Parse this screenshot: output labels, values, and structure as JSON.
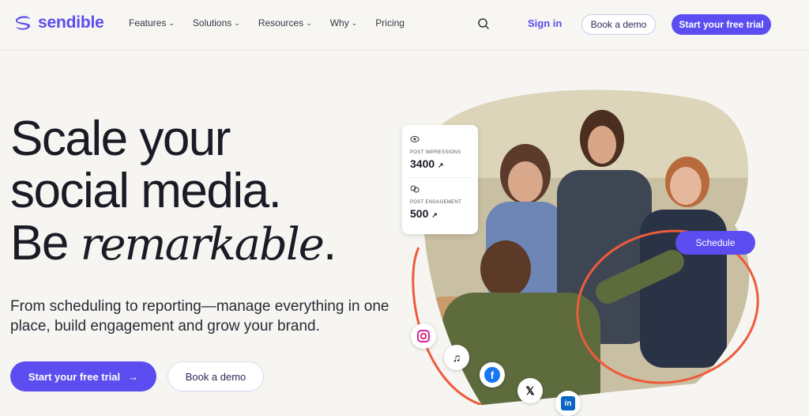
{
  "brand": {
    "name": "sendible",
    "color": "#5b4df0"
  },
  "nav": {
    "items": [
      {
        "label": "Features",
        "has_dropdown": true
      },
      {
        "label": "Solutions",
        "has_dropdown": true
      },
      {
        "label": "Resources",
        "has_dropdown": true
      },
      {
        "label": "Why",
        "has_dropdown": true
      },
      {
        "label": "Pricing",
        "has_dropdown": false
      }
    ],
    "search_icon": "search-icon",
    "sign_in": "Sign in",
    "book_demo": "Book a demo",
    "start_trial": "Start your free trial"
  },
  "hero": {
    "line1": "Scale your",
    "line2": "social media.",
    "line3_prefix": "Be ",
    "line3_italic": "remarkable",
    "line3_suffix": ".",
    "subtitle": "From scheduling to reporting—manage everything in one place, build engagement and grow your brand.",
    "cta_primary": "Start your free trial",
    "cta_primary_icon": "arrow-right-icon",
    "cta_secondary": "Book a demo"
  },
  "stats_card": {
    "impressions_label": "POST IMPRESSIONS",
    "impressions_value": "3400",
    "engagement_label": "POST ENGAGEMENT",
    "engagement_value": "500"
  },
  "schedule_label": "Schedule",
  "social_icons": [
    "instagram-icon",
    "tiktok-icon",
    "facebook-icon",
    "x-icon",
    "linkedin-icon"
  ]
}
